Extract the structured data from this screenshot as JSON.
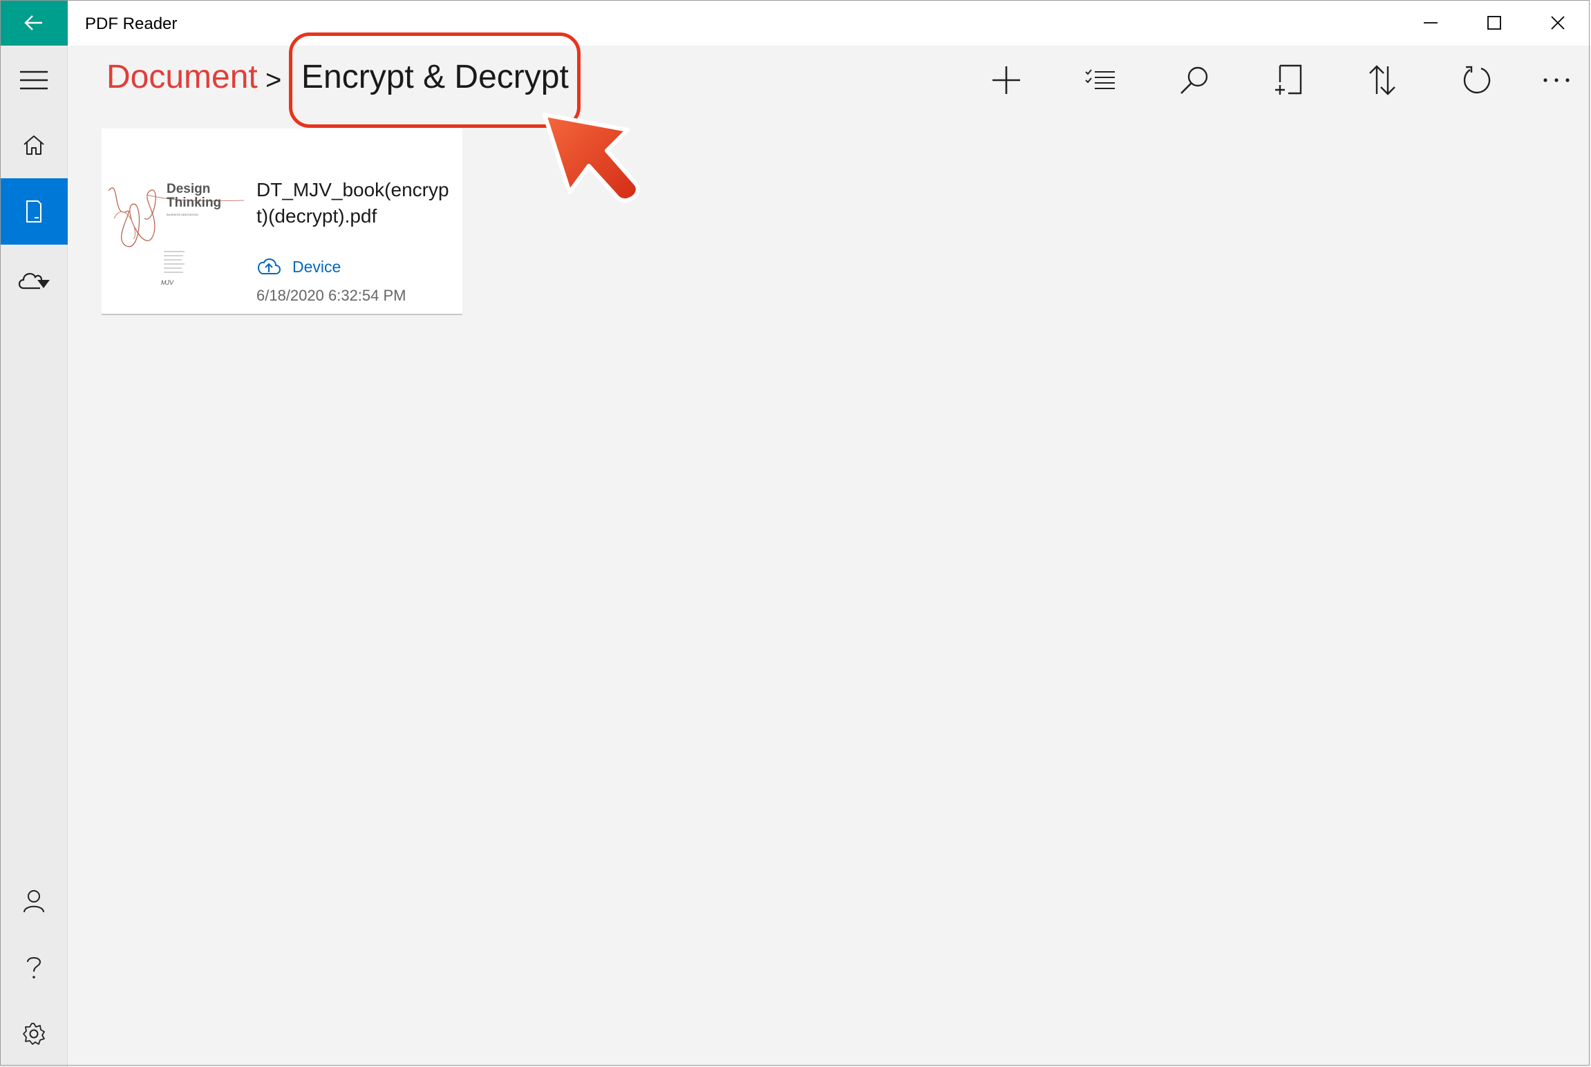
{
  "window": {
    "title": "PDF Reader"
  },
  "nav": {
    "items": [
      {
        "name": "hamburger-menu",
        "icon": "hamburger-icon"
      },
      {
        "name": "home",
        "icon": "home-icon"
      },
      {
        "name": "document",
        "icon": "document-icon",
        "active": true
      },
      {
        "name": "cloud",
        "icon": "cloud-download-icon"
      },
      {
        "name": "account",
        "icon": "person-icon"
      },
      {
        "name": "help",
        "icon": "help-icon"
      },
      {
        "name": "settings",
        "icon": "gear-icon"
      }
    ]
  },
  "breadcrumb": {
    "parent": "Document",
    "separator": ">",
    "current": "Encrypt & Decrypt"
  },
  "toolbar": {
    "buttons": [
      "add-icon",
      "select-list-icon",
      "search-icon",
      "new-folder-icon",
      "sort-icon",
      "refresh-icon",
      "more-icon"
    ]
  },
  "files": [
    {
      "name": "DT_MJV_book(encrypt)(decrypt).pdf",
      "location": "Device",
      "date": "6/18/2020 6:32:54 PM",
      "thumbnail": {
        "title_line1": "Design",
        "title_line2": "Thinking",
        "subtitle": "BUSINESS INNOVATION",
        "logo": "MJV"
      }
    }
  ],
  "colors": {
    "accent": "#0078d7",
    "back_button": "#009e8c",
    "breadcrumb_parent": "#e03e3a",
    "annotation": "#e8341c",
    "link": "#0067c0"
  }
}
